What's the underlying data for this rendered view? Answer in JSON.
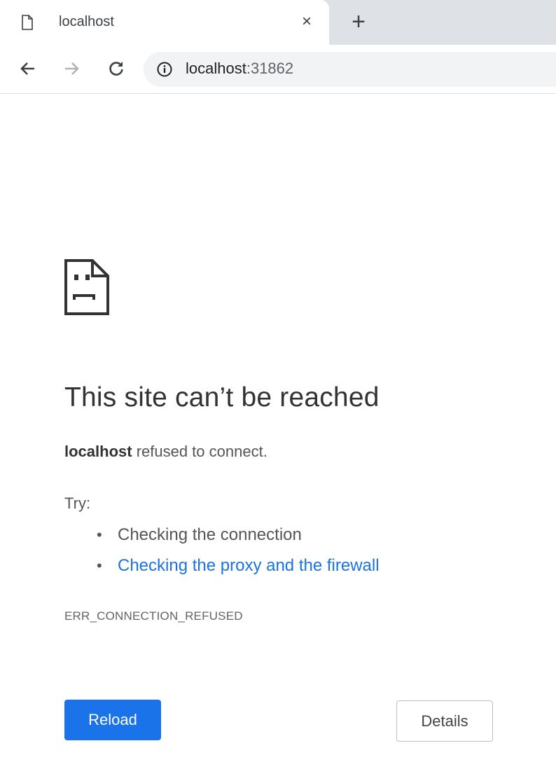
{
  "tab": {
    "title": "localhost",
    "close_symbol": "×",
    "new_tab_symbol": "+",
    "icon": "page-icon"
  },
  "toolbar": {
    "back_icon": "arrow-left-icon",
    "forward_icon": "arrow-right-icon",
    "reload_icon": "reload-icon",
    "url_host": "localhost",
    "url_port": ":31862",
    "info_icon": "info-icon"
  },
  "error": {
    "icon": "sad-page-icon",
    "heading": "This site can’t be reached",
    "host": "localhost",
    "summary_rest": " refused to connect.",
    "try_label": "Try:",
    "suggestions": [
      {
        "text": "Checking the connection",
        "is_link": false
      },
      {
        "text": "Checking the proxy and the firewall",
        "is_link": true
      }
    ],
    "code": "ERR_CONNECTION_REFUSED"
  },
  "buttons": {
    "reload_label": "Reload",
    "details_label": "Details"
  },
  "colors": {
    "accent": "#1a73e8",
    "tabstrip": "#dee1e6",
    "omnibox": "#f1f3f4"
  }
}
